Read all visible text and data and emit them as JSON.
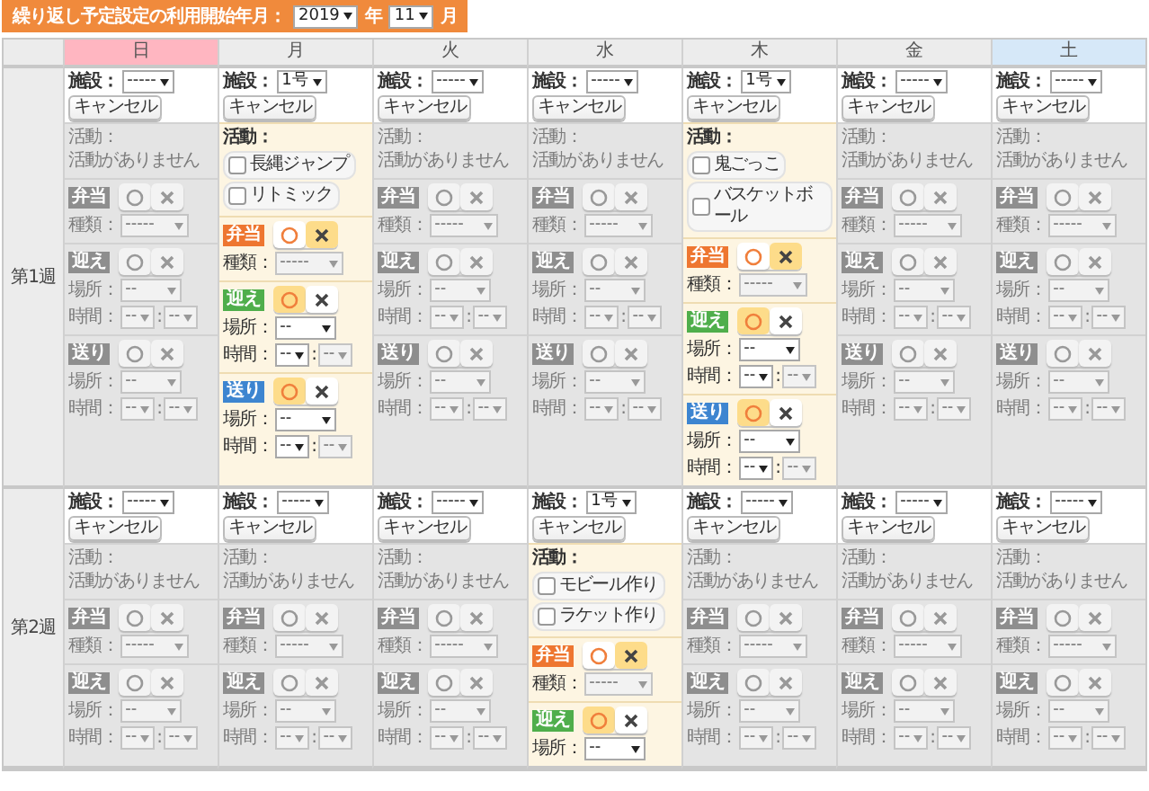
{
  "header": {
    "label": "繰り返し予定設定の利用開始年月：",
    "year": "2019",
    "year_unit": "年",
    "month": "11",
    "month_unit": "月"
  },
  "days": [
    {
      "label": "日",
      "kind": "sunday"
    },
    {
      "label": "月",
      "kind": "weekday"
    },
    {
      "label": "火",
      "kind": "weekday"
    },
    {
      "label": "水",
      "kind": "weekday"
    },
    {
      "label": "木",
      "kind": "weekday"
    },
    {
      "label": "金",
      "kind": "weekday"
    },
    {
      "label": "土",
      "kind": "saturday"
    }
  ],
  "weeks": [
    {
      "label": "第1週",
      "cells": [
        {
          "active": false,
          "facility_label": "施設：",
          "facility": "-----",
          "cancel": "キャンセル",
          "activity_label": "活動：",
          "empty": "活動がありません",
          "services": [
            {
              "kind": "lunch",
              "badge": "弁当",
              "yes_selected": false,
              "no_selected": false,
              "fields": [
                {
                  "label": "種類：",
                  "value": "-----"
                }
              ]
            },
            {
              "kind": "pickup",
              "badge": "迎え",
              "yes_selected": false,
              "no_selected": false,
              "fields": [
                {
                  "label": "場所：",
                  "place": "--"
                },
                {
                  "label": "時間：",
                  "hour": "--",
                  "separator": ":",
                  "minute": "--"
                }
              ]
            },
            {
              "kind": "dropoff",
              "badge": "送り",
              "yes_selected": false,
              "no_selected": false,
              "fields": [
                {
                  "label": "場所：",
                  "place": "--"
                },
                {
                  "label": "時間：",
                  "hour": "--",
                  "separator": ":",
                  "minute": "--"
                }
              ]
            }
          ]
        },
        {
          "active": true,
          "facility_label": "施設：",
          "facility": "1号",
          "cancel": "キャンセル",
          "activity_label": "活動：",
          "activities": [
            {
              "label": "長縄ジャンプ",
              "checked": false
            },
            {
              "label": "リトミック",
              "checked": false
            }
          ],
          "services": [
            {
              "kind": "lunch",
              "badge": "弁当",
              "yes_selected": false,
              "no_selected": true,
              "fields": [
                {
                  "label": "種類：",
                  "value": "-----"
                }
              ]
            },
            {
              "kind": "pickup",
              "badge": "迎え",
              "yes_selected": true,
              "no_selected": false,
              "fields": [
                {
                  "label": "場所：",
                  "place": "--"
                },
                {
                  "label": "時間：",
                  "hour": "--",
                  "separator": ":",
                  "minute": "--"
                }
              ]
            },
            {
              "kind": "dropoff",
              "badge": "送り",
              "yes_selected": true,
              "no_selected": false,
              "fields": [
                {
                  "label": "場所：",
                  "place": "--"
                },
                {
                  "label": "時間：",
                  "hour": "--",
                  "separator": ":",
                  "minute": "--"
                }
              ]
            }
          ]
        },
        {
          "active": false,
          "facility_label": "施設：",
          "facility": "-----",
          "cancel": "キャンセル",
          "activity_label": "活動：",
          "empty": "活動がありません",
          "services": [
            {
              "kind": "lunch",
              "badge": "弁当",
              "yes_selected": false,
              "no_selected": false,
              "fields": [
                {
                  "label": "種類：",
                  "value": "-----"
                }
              ]
            },
            {
              "kind": "pickup",
              "badge": "迎え",
              "yes_selected": false,
              "no_selected": false,
              "fields": [
                {
                  "label": "場所：",
                  "place": "--"
                },
                {
                  "label": "時間：",
                  "hour": "--",
                  "separator": ":",
                  "minute": "--"
                }
              ]
            },
            {
              "kind": "dropoff",
              "badge": "送り",
              "yes_selected": false,
              "no_selected": false,
              "fields": [
                {
                  "label": "場所：",
                  "place": "--"
                },
                {
                  "label": "時間：",
                  "hour": "--",
                  "separator": ":",
                  "minute": "--"
                }
              ]
            }
          ]
        },
        {
          "active": false,
          "facility_label": "施設：",
          "facility": "-----",
          "cancel": "キャンセル",
          "activity_label": "活動：",
          "empty": "活動がありません",
          "services": [
            {
              "kind": "lunch",
              "badge": "弁当",
              "yes_selected": false,
              "no_selected": false,
              "fields": [
                {
                  "label": "種類：",
                  "value": "-----"
                }
              ]
            },
            {
              "kind": "pickup",
              "badge": "迎え",
              "yes_selected": false,
              "no_selected": false,
              "fields": [
                {
                  "label": "場所：",
                  "place": "--"
                },
                {
                  "label": "時間：",
                  "hour": "--",
                  "separator": ":",
                  "minute": "--"
                }
              ]
            },
            {
              "kind": "dropoff",
              "badge": "送り",
              "yes_selected": false,
              "no_selected": false,
              "fields": [
                {
                  "label": "場所：",
                  "place": "--"
                },
                {
                  "label": "時間：",
                  "hour": "--",
                  "separator": ":",
                  "minute": "--"
                }
              ]
            }
          ]
        },
        {
          "active": true,
          "facility_label": "施設：",
          "facility": "1号",
          "cancel": "キャンセル",
          "activity_label": "活動：",
          "activities": [
            {
              "label": "鬼ごっこ",
              "checked": false
            },
            {
              "label": "バスケットボール",
              "checked": false
            }
          ],
          "services": [
            {
              "kind": "lunch",
              "badge": "弁当",
              "yes_selected": false,
              "no_selected": true,
              "fields": [
                {
                  "label": "種類：",
                  "value": "-----"
                }
              ]
            },
            {
              "kind": "pickup",
              "badge": "迎え",
              "yes_selected": true,
              "no_selected": false,
              "fields": [
                {
                  "label": "場所：",
                  "place": "--"
                },
                {
                  "label": "時間：",
                  "hour": "--",
                  "separator": ":",
                  "minute": "--"
                }
              ]
            },
            {
              "kind": "dropoff",
              "badge": "送り",
              "yes_selected": true,
              "no_selected": false,
              "fields": [
                {
                  "label": "場所：",
                  "place": "--"
                },
                {
                  "label": "時間：",
                  "hour": "--",
                  "separator": ":",
                  "minute": "--"
                }
              ]
            }
          ]
        },
        {
          "active": false,
          "facility_label": "施設：",
          "facility": "-----",
          "cancel": "キャンセル",
          "activity_label": "活動：",
          "empty": "活動がありません",
          "services": [
            {
              "kind": "lunch",
              "badge": "弁当",
              "yes_selected": false,
              "no_selected": false,
              "fields": [
                {
                  "label": "種類：",
                  "value": "-----"
                }
              ]
            },
            {
              "kind": "pickup",
              "badge": "迎え",
              "yes_selected": false,
              "no_selected": false,
              "fields": [
                {
                  "label": "場所：",
                  "place": "--"
                },
                {
                  "label": "時間：",
                  "hour": "--",
                  "separator": ":",
                  "minute": "--"
                }
              ]
            },
            {
              "kind": "dropoff",
              "badge": "送り",
              "yes_selected": false,
              "no_selected": false,
              "fields": [
                {
                  "label": "場所：",
                  "place": "--"
                },
                {
                  "label": "時間：",
                  "hour": "--",
                  "separator": ":",
                  "minute": "--"
                }
              ]
            }
          ]
        },
        {
          "active": false,
          "facility_label": "施設：",
          "facility": "-----",
          "cancel": "キャンセル",
          "activity_label": "活動：",
          "empty": "活動がありません",
          "services": [
            {
              "kind": "lunch",
              "badge": "弁当",
              "yes_selected": false,
              "no_selected": false,
              "fields": [
                {
                  "label": "種類：",
                  "value": "-----"
                }
              ]
            },
            {
              "kind": "pickup",
              "badge": "迎え",
              "yes_selected": false,
              "no_selected": false,
              "fields": [
                {
                  "label": "場所：",
                  "place": "--"
                },
                {
                  "label": "時間：",
                  "hour": "--",
                  "separator": ":",
                  "minute": "--"
                }
              ]
            },
            {
              "kind": "dropoff",
              "badge": "送り",
              "yes_selected": false,
              "no_selected": false,
              "fields": [
                {
                  "label": "場所：",
                  "place": "--"
                },
                {
                  "label": "時間：",
                  "hour": "--",
                  "separator": ":",
                  "minute": "--"
                }
              ]
            }
          ]
        }
      ]
    },
    {
      "label": "第2週",
      "cells": [
        {
          "active": false,
          "facility_label": "施設：",
          "facility": "-----",
          "cancel": "キャンセル",
          "activity_label": "活動：",
          "empty": "活動がありません",
          "services": [
            {
              "kind": "lunch",
              "badge": "弁当",
              "yes_selected": false,
              "no_selected": false,
              "fields": [
                {
                  "label": "種類：",
                  "value": "-----"
                }
              ]
            },
            {
              "kind": "pickup",
              "badge": "迎え",
              "yes_selected": false,
              "no_selected": false,
              "fields": [
                {
                  "label": "場所：",
                  "place": "--"
                },
                {
                  "label": "時間：",
                  "hour": "--",
                  "separator": ":",
                  "minute": "--"
                }
              ]
            }
          ]
        },
        {
          "active": false,
          "facility_label": "施設：",
          "facility": "-----",
          "cancel": "キャンセル",
          "activity_label": "活動：",
          "empty": "活動がありません",
          "services": [
            {
              "kind": "lunch",
              "badge": "弁当",
              "yes_selected": false,
              "no_selected": false,
              "fields": [
                {
                  "label": "種類：",
                  "value": "-----"
                }
              ]
            },
            {
              "kind": "pickup",
              "badge": "迎え",
              "yes_selected": false,
              "no_selected": false,
              "fields": [
                {
                  "label": "場所：",
                  "place": "--"
                },
                {
                  "label": "時間：",
                  "hour": "--",
                  "separator": ":",
                  "minute": "--"
                }
              ]
            }
          ]
        },
        {
          "active": false,
          "facility_label": "施設：",
          "facility": "-----",
          "cancel": "キャンセル",
          "activity_label": "活動：",
          "empty": "活動がありません",
          "services": [
            {
              "kind": "lunch",
              "badge": "弁当",
              "yes_selected": false,
              "no_selected": false,
              "fields": [
                {
                  "label": "種類：",
                  "value": "-----"
                }
              ]
            },
            {
              "kind": "pickup",
              "badge": "迎え",
              "yes_selected": false,
              "no_selected": false,
              "fields": [
                {
                  "label": "場所：",
                  "place": "--"
                },
                {
                  "label": "時間：",
                  "hour": "--",
                  "separator": ":",
                  "minute": "--"
                }
              ]
            }
          ]
        },
        {
          "active": true,
          "facility_label": "施設：",
          "facility": "1号",
          "cancel": "キャンセル",
          "activity_label": "活動：",
          "activities": [
            {
              "label": "モビール作り",
              "checked": false
            },
            {
              "label": "ラケット作り",
              "checked": false
            }
          ],
          "services": [
            {
              "kind": "lunch",
              "badge": "弁当",
              "yes_selected": false,
              "no_selected": true,
              "fields": [
                {
                  "label": "種類：",
                  "value": "-----"
                }
              ]
            },
            {
              "kind": "pickup",
              "badge": "迎え",
              "yes_selected": true,
              "no_selected": false,
              "fields": [
                {
                  "label": "場所：",
                  "place": "--"
                }
              ]
            }
          ]
        },
        {
          "active": false,
          "facility_label": "施設：",
          "facility": "-----",
          "cancel": "キャンセル",
          "activity_label": "活動：",
          "empty": "活動がありません",
          "services": [
            {
              "kind": "lunch",
              "badge": "弁当",
              "yes_selected": false,
              "no_selected": false,
              "fields": [
                {
                  "label": "種類：",
                  "value": "-----"
                }
              ]
            },
            {
              "kind": "pickup",
              "badge": "迎え",
              "yes_selected": false,
              "no_selected": false,
              "fields": [
                {
                  "label": "場所：",
                  "place": "--"
                },
                {
                  "label": "時間：",
                  "hour": "--",
                  "separator": ":",
                  "minute": "--"
                }
              ]
            }
          ]
        },
        {
          "active": false,
          "facility_label": "施設：",
          "facility": "-----",
          "cancel": "キャンセル",
          "activity_label": "活動：",
          "empty": "活動がありません",
          "services": [
            {
              "kind": "lunch",
              "badge": "弁当",
              "yes_selected": false,
              "no_selected": false,
              "fields": [
                {
                  "label": "種類：",
                  "value": "-----"
                }
              ]
            },
            {
              "kind": "pickup",
              "badge": "迎え",
              "yes_selected": false,
              "no_selected": false,
              "fields": [
                {
                  "label": "場所：",
                  "place": "--"
                },
                {
                  "label": "時間：",
                  "hour": "--",
                  "separator": ":",
                  "minute": "--"
                }
              ]
            }
          ]
        },
        {
          "active": false,
          "facility_label": "施設：",
          "facility": "-----",
          "cancel": "キャンセル",
          "activity_label": "活動：",
          "empty": "活動がありません",
          "services": [
            {
              "kind": "lunch",
              "badge": "弁当",
              "yes_selected": false,
              "no_selected": false,
              "fields": [
                {
                  "label": "種類：",
                  "value": "-----"
                }
              ]
            },
            {
              "kind": "pickup",
              "badge": "迎え",
              "yes_selected": false,
              "no_selected": false,
              "fields": [
                {
                  "label": "場所：",
                  "place": "--"
                },
                {
                  "label": "時間：",
                  "hour": "--",
                  "separator": ":",
                  "minute": "--"
                }
              ]
            }
          ]
        }
      ]
    }
  ]
}
